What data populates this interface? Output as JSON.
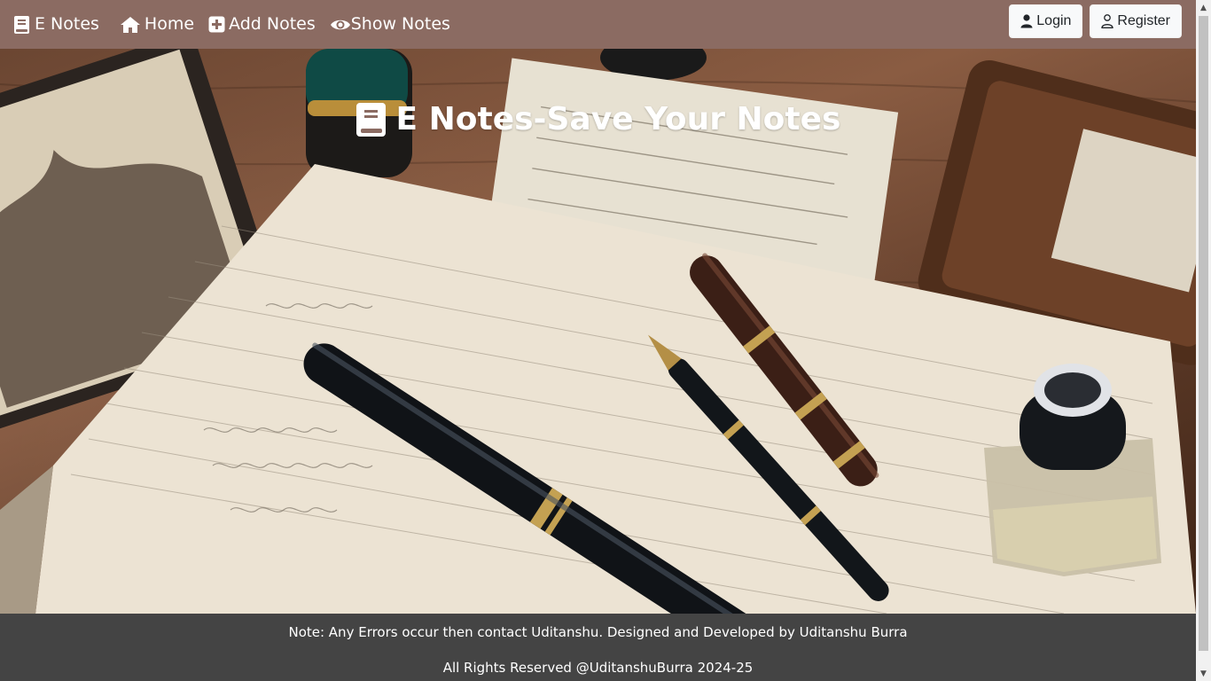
{
  "navbar": {
    "brand": {
      "icon": "book-icon",
      "label": "E Notes"
    },
    "links": [
      {
        "icon": "home-icon",
        "label": "Home"
      },
      {
        "icon": "plus-square-icon",
        "label": "Add Notes"
      },
      {
        "icon": "eye-icon",
        "label": "Show Notes"
      }
    ],
    "login_label": "Login",
    "register_label": "Register",
    "login_icon": "user-filled-icon",
    "register_icon": "user-outline-icon"
  },
  "hero": {
    "title": "E Notes-Save Your Notes",
    "title_icon": "book-icon",
    "background_image": "desk-with-notebook-and-fountain-pens"
  },
  "footer": {
    "line1": "Note: Any Errors occur then contact Uditanshu. Designed and Developed by Uditanshu Burra",
    "line2": "All Rights Reserved @UditanshuBurra 2024-25"
  },
  "colors": {
    "navbar_bg": "#8b6b62",
    "footer_bg": "#444444",
    "button_bg": "#f8f9fa",
    "text_light": "#ffffff"
  }
}
